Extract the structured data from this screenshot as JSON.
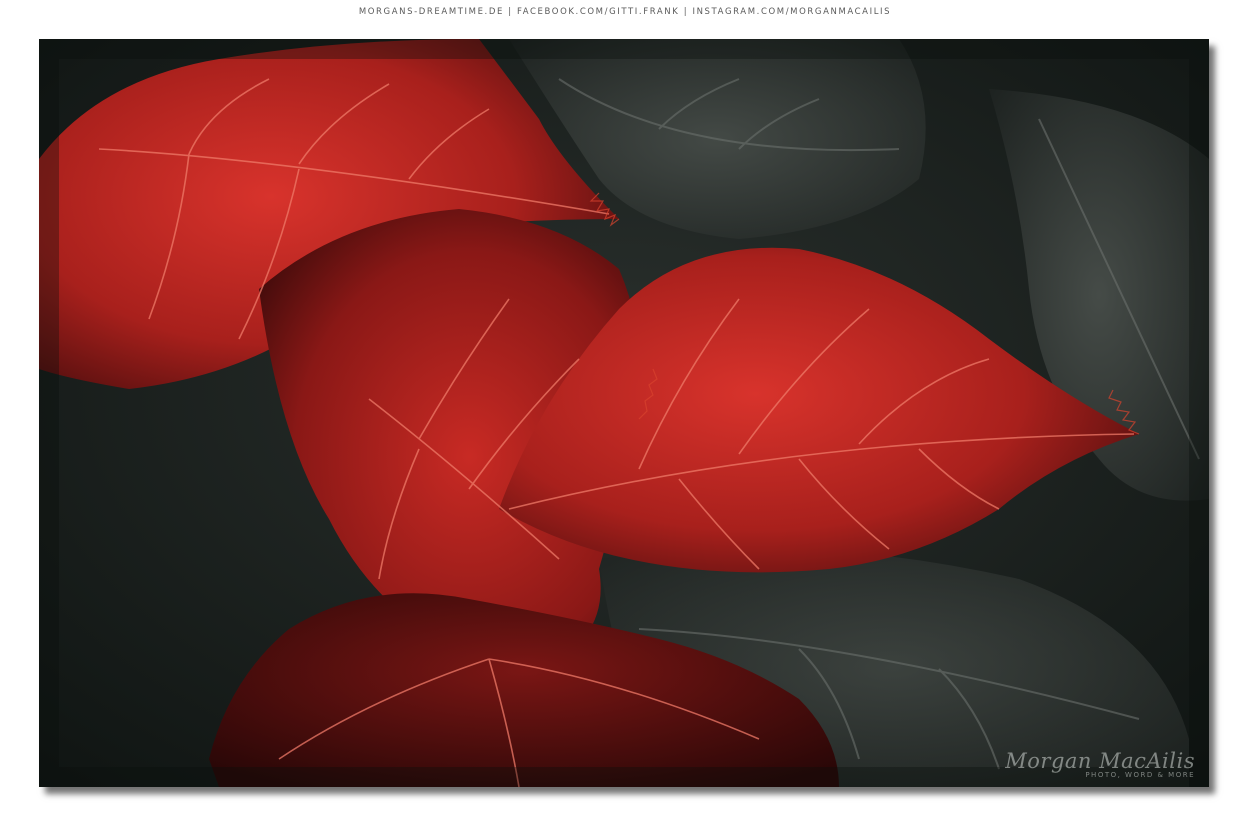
{
  "header": {
    "links": "MORGANS-DREAMTIME.DE  |  FACEBOOK.COM/GITTI.FRANK  |  INSTAGRAM.COM/MORGANMACAILIS"
  },
  "watermark": {
    "name": "Morgan MacAilis",
    "tagline": "PHOTO, WORD & MORE"
  },
  "photo": {
    "subject_icon": "red-leaves-photo",
    "colors": {
      "background": "#141a18",
      "leaf_red": "#c42a26",
      "leaf_dark_red": "#5a1212",
      "leaf_gray": "#3a403d",
      "vein": "#e86a5a"
    }
  }
}
